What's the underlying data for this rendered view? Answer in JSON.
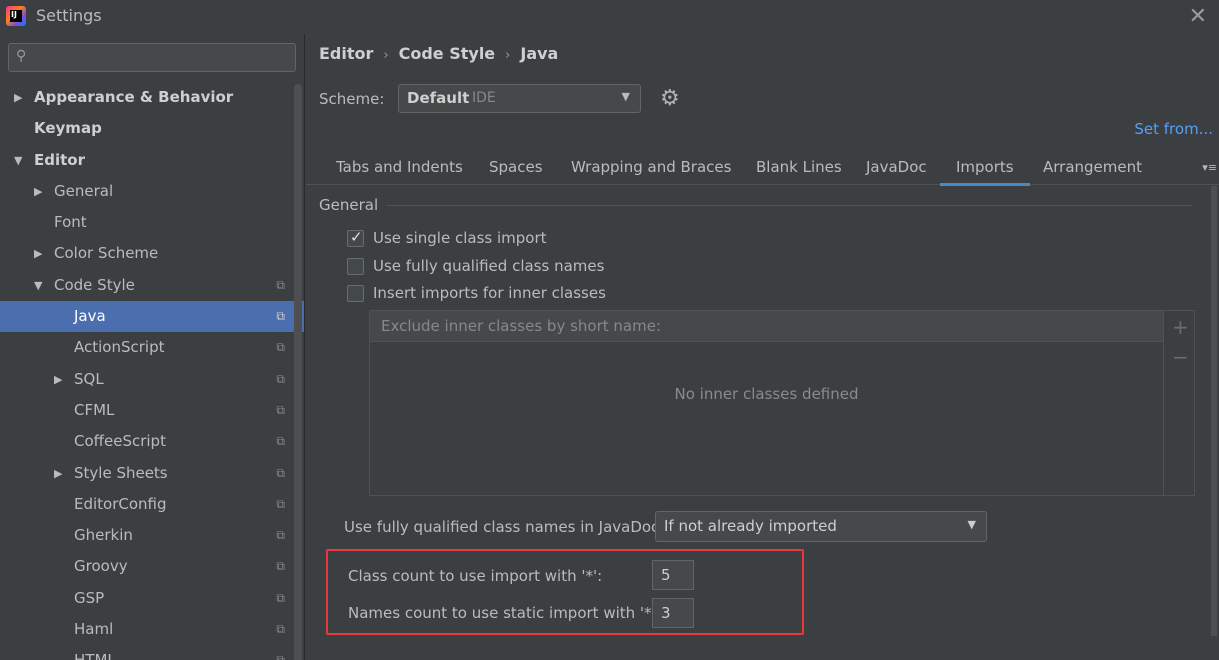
{
  "window": {
    "title": "Settings",
    "app_icon_text": "IJ"
  },
  "search": {
    "placeholder": ""
  },
  "tree": [
    {
      "label": "Appearance & Behavior",
      "level": 0,
      "arrow": "right",
      "bold": true,
      "copy": false
    },
    {
      "label": "Keymap",
      "level": 0,
      "arrow": "",
      "bold": true,
      "copy": false
    },
    {
      "label": "Editor",
      "level": 0,
      "arrow": "down",
      "bold": true,
      "copy": false
    },
    {
      "label": "General",
      "level": 1,
      "arrow": "right",
      "bold": false,
      "copy": false
    },
    {
      "label": "Font",
      "level": 1,
      "arrow": "",
      "bold": false,
      "copy": false
    },
    {
      "label": "Color Scheme",
      "level": 1,
      "arrow": "right",
      "bold": false,
      "copy": false
    },
    {
      "label": "Code Style",
      "level": 1,
      "arrow": "down",
      "bold": false,
      "copy": true
    },
    {
      "label": "Java",
      "level": 2,
      "arrow": "",
      "bold": false,
      "copy": true,
      "selected": true
    },
    {
      "label": "ActionScript",
      "level": 2,
      "arrow": "",
      "bold": false,
      "copy": true
    },
    {
      "label": "SQL",
      "level": 2,
      "arrow": "right",
      "bold": false,
      "copy": true
    },
    {
      "label": "CFML",
      "level": 2,
      "arrow": "",
      "bold": false,
      "copy": true
    },
    {
      "label": "CoffeeScript",
      "level": 2,
      "arrow": "",
      "bold": false,
      "copy": true
    },
    {
      "label": "Style Sheets",
      "level": 2,
      "arrow": "right",
      "bold": false,
      "copy": true
    },
    {
      "label": "EditorConfig",
      "level": 2,
      "arrow": "",
      "bold": false,
      "copy": true
    },
    {
      "label": "Gherkin",
      "level": 2,
      "arrow": "",
      "bold": false,
      "copy": true
    },
    {
      "label": "Groovy",
      "level": 2,
      "arrow": "",
      "bold": false,
      "copy": true
    },
    {
      "label": "GSP",
      "level": 2,
      "arrow": "",
      "bold": false,
      "copy": true
    },
    {
      "label": "Haml",
      "level": 2,
      "arrow": "",
      "bold": false,
      "copy": true
    },
    {
      "label": "HTML",
      "level": 2,
      "arrow": "",
      "bold": false,
      "copy": true
    }
  ],
  "breadcrumb": {
    "part1": "Editor",
    "sep1": "›",
    "part2": "Code Style",
    "sep2": "›",
    "part3": "Java"
  },
  "scheme": {
    "label": "Scheme:",
    "value": "Default",
    "sub": "IDE",
    "set_from": "Set from..."
  },
  "tabs": [
    "Tabs and Indents",
    "Spaces",
    "Wrapping and Braces",
    "Blank Lines",
    "JavaDoc",
    "Imports",
    "Arrangement"
  ],
  "active_tab": "Imports",
  "general": {
    "title": "General",
    "single_class_import": {
      "label": "Use single class import",
      "checked": true
    },
    "fully_qualified": {
      "label": "Use fully qualified class names",
      "checked": false
    },
    "inner_classes": {
      "label": "Insert imports for inner classes",
      "checked": false
    }
  },
  "exclude": {
    "header": "Exclude inner classes by short name:",
    "empty": "No inner classes defined",
    "add": "+",
    "remove": "−"
  },
  "javadoc": {
    "label": "Use fully qualified class names in JavaDoc:",
    "value": "If not already imported"
  },
  "counts": {
    "class_label": "Class count to use import with '*':",
    "class_value": "5",
    "names_label": "Names count to use static import with '*':",
    "names_value": "3"
  },
  "colors": {
    "accent": "#4b6eaf",
    "tab_underline": "#4a88c7",
    "highlight": "#e8383d",
    "link": "#589df6"
  }
}
